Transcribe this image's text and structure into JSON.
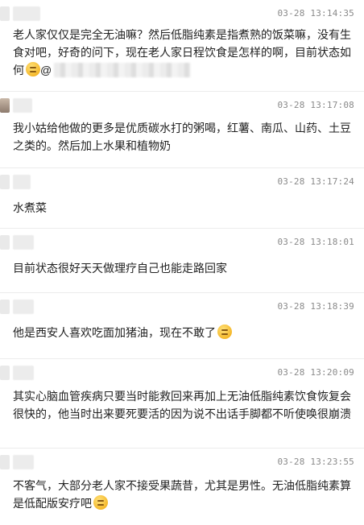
{
  "comments": [
    {
      "time": "03-28 13:14:35",
      "text": "老人家仅仅是完全无油嘛？然后低脂纯素是指煮熟的饭菜嘛，没有生食对吧，好奇的问下，现在老人家日程饮食是怎样的啊，目前状态如何",
      "emoji": "thinking-face",
      "mention_prefix": "@"
    },
    {
      "time": "03-28 13:17:08",
      "text": "我小姑给他做的更多是优质碳水打的粥喝，红薯、南瓜、山药、土豆之类的。然后加上水果和植物奶"
    },
    {
      "time": "03-28 13:17:24",
      "text": "水煮菜"
    },
    {
      "time": "03-28 13:18:01",
      "text": "目前状态很好天天做理疗自己也能走路回家"
    },
    {
      "time": "03-28 13:18:39",
      "text": "他是西安人喜欢吃面加猪油，现在不敢了",
      "emoji": "thinking-face"
    },
    {
      "time": "03-28 13:20:09",
      "text": "其实心脑血管疾病只要当时能救回来再加上无油低脂纯素饮食恢复会很快的，他当时出来要死要活的因为说不出话手脚都不听使唤很崩溃"
    },
    {
      "time": "03-28 13:23:55",
      "text": "不客气，大部分老人家不接受果蔬昔，尤其是男性。无油低脂纯素算是低配版安疗吧",
      "emoji": "laughing-face"
    }
  ]
}
